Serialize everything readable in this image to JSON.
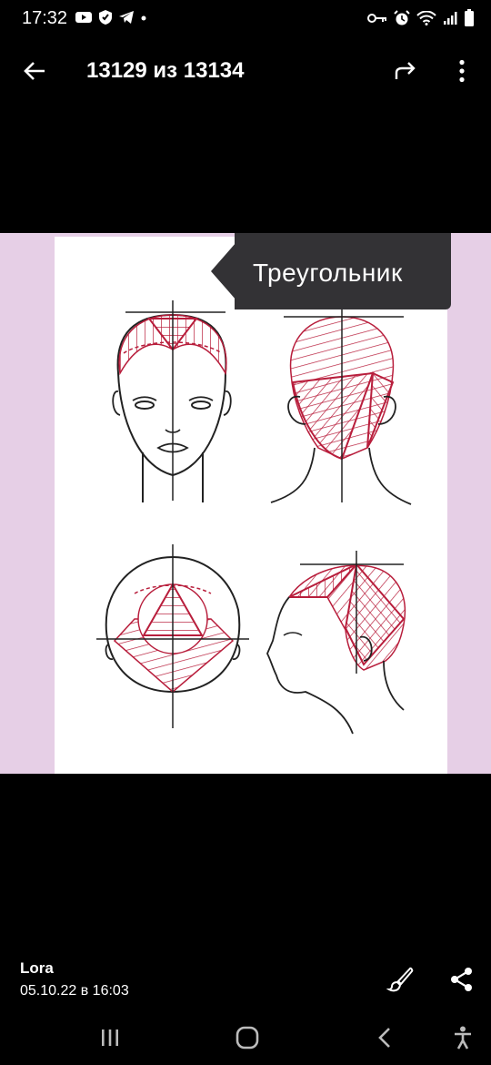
{
  "status_bar": {
    "time": "17:32"
  },
  "app_bar": {
    "title": "13129 из 13134"
  },
  "image": {
    "caption": "Треугольник",
    "background_color": "#e6cfe6",
    "line_color": "#b81e3c"
  },
  "footer": {
    "author": "Lora",
    "date": "05.10.22 в 16:03"
  },
  "icons": [
    "youtube-icon",
    "shield-icon",
    "telegram-icon",
    "key-icon",
    "alarm-icon",
    "wifi-icon",
    "signal-icon",
    "battery-icon",
    "back-arrow-icon",
    "forward-share-icon",
    "more-vert-icon",
    "brush-icon",
    "share-icon",
    "recents-icon",
    "home-icon",
    "nav-back-icon",
    "accessibility-icon"
  ]
}
